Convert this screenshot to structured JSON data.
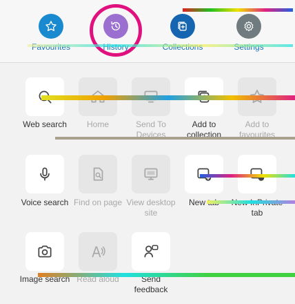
{
  "top_nav": {
    "favourites": "Favourites",
    "history": "History",
    "collections": "Collections",
    "settings": "Settings"
  },
  "actions": {
    "web_search": "Web search",
    "home": "Home",
    "send_to_devices": "Send To Devices",
    "add_to_collection": "Add to collection",
    "add_to_favourites": "Add to favourites",
    "voice_search": "Voice search",
    "find_on_page": "Find on page",
    "view_desktop_site": "View desktop site",
    "new_tab": "New tab",
    "new_inprivate_tab": "New InPrivate tab",
    "image_search": "Image search",
    "read_aloud": "Read aloud",
    "send_feedback": "Send feedback"
  },
  "colors": {
    "accent_blue": "#1a73b8",
    "history_purple": "#9b6fd0",
    "highlight_ring": "#e0107e",
    "settings_gray": "#6f7b7e"
  }
}
